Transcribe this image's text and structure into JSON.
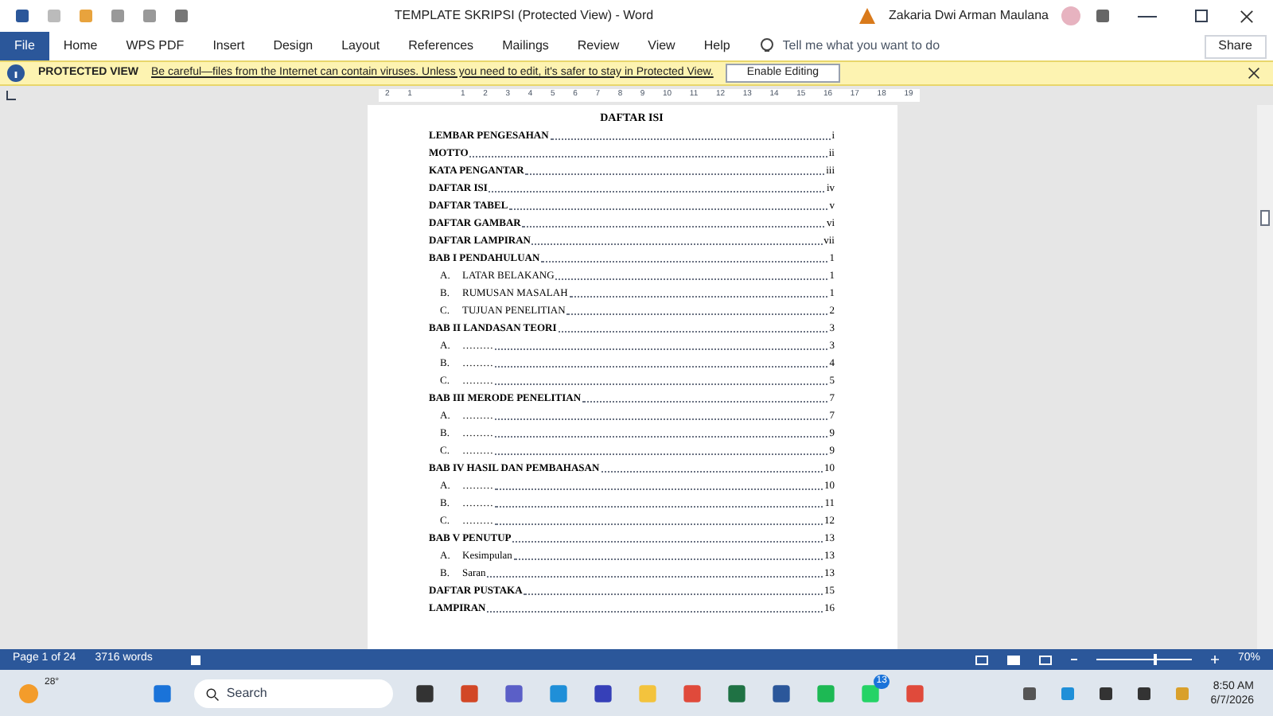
{
  "window": {
    "title": "TEMPLATE SKRIPSI (Protected View)  -  Word",
    "user": "Zakaria Dwi Arman Maulana"
  },
  "ribbon": {
    "tabs": [
      {
        "label": "File",
        "selected": true
      },
      {
        "label": "Home",
        "selected": false
      },
      {
        "label": "WPS PDF",
        "selected": false
      },
      {
        "label": "Insert",
        "selected": false
      },
      {
        "label": "Design",
        "selected": false
      },
      {
        "label": "Layout",
        "selected": false
      },
      {
        "label": "References",
        "selected": false
      },
      {
        "label": "Mailings",
        "selected": false
      },
      {
        "label": "Review",
        "selected": false
      },
      {
        "label": "View",
        "selected": false
      },
      {
        "label": "Help",
        "selected": false
      }
    ],
    "tell_me": {
      "placeholder": "Tell me what you want to do"
    },
    "share": "Share"
  },
  "protected_view": {
    "label": "PROTECTED VIEW",
    "message": "Be careful—files from the Internet can contain viruses. Unless you need to edit, it's safer to stay in Protected View.",
    "button": "Enable Editing"
  },
  "ruler": {
    "left_marks": [
      "2",
      "1"
    ],
    "marks": [
      "1",
      "2",
      "3",
      "4",
      "5",
      "6",
      "7",
      "8",
      "9",
      "10",
      "11",
      "12",
      "13",
      "14",
      "15",
      "16",
      "17",
      "18",
      "19"
    ]
  },
  "document": {
    "heading": "DAFTAR ISI",
    "toc": [
      {
        "title": "LEMBAR PENGESAHAN",
        "page": "i"
      },
      {
        "title": "MOTTO",
        "page": "ii"
      },
      {
        "title": "KATA PENGANTAR",
        "page": "iii"
      },
      {
        "title": "DAFTAR ISI",
        "page": "iv"
      },
      {
        "title": "DAFTAR TABEL",
        "page": "v"
      },
      {
        "title": "DAFTAR GAMBAR",
        "page": "vi"
      },
      {
        "title": "DAFTAR LAMPIRAN",
        "page": "vii"
      },
      {
        "title": "BAB I PENDAHULUAN",
        "page": "1",
        "children": [
          {
            "label": "A.",
            "title": "LATAR BELAKANG",
            "page": "1"
          },
          {
            "label": "B.",
            "title": "RUMUSAN MASALAH",
            "page": "1"
          },
          {
            "label": "C.",
            "title": "TUJUAN PENELITIAN",
            "page": "2"
          }
        ]
      },
      {
        "title": "BAB II LANDASAN TEORI",
        "page": "3",
        "children": [
          {
            "label": "A.",
            "title": "………",
            "page": "3"
          },
          {
            "label": "B.",
            "title": "………",
            "page": "4"
          },
          {
            "label": "C.",
            "title": "………",
            "page": "5"
          }
        ]
      },
      {
        "title": "BAB III MERODE PENELITIAN",
        "page": "7",
        "children": [
          {
            "label": "A.",
            "title": "………",
            "page": "7"
          },
          {
            "label": "B.",
            "title": "………",
            "page": "9"
          },
          {
            "label": "C.",
            "title": "………",
            "page": "9"
          }
        ]
      },
      {
        "title": "BAB IV HASIL DAN PEMBAHASAN",
        "page": "10",
        "children": [
          {
            "label": "A.",
            "title": "………",
            "page": "10"
          },
          {
            "label": "B.",
            "title": "………",
            "page": "11"
          },
          {
            "label": "C.",
            "title": "………",
            "page": "12"
          }
        ]
      },
      {
        "title": "BAB V PENUTUP",
        "page": "13",
        "children": [
          {
            "label": "A.",
            "title": "Kesimpulan",
            "page": "13"
          },
          {
            "label": "B.",
            "title": "Saran",
            "page": "13"
          }
        ]
      },
      {
        "title": "DAFTAR PUSTAKA",
        "page": "15"
      },
      {
        "title": "LAMPIRAN",
        "page": "16"
      }
    ]
  },
  "status_bar": {
    "page": "Page 1 of 24",
    "words": "3716 words",
    "zoom_slider": {
      "level": 0.6
    },
    "zoom": "70%"
  },
  "taskbar": {
    "weather": "28°",
    "search": {
      "placeholder": "Search"
    },
    "whatsapp_badge": "13",
    "time": "8:50 AM",
    "date": "6/7/2026"
  }
}
